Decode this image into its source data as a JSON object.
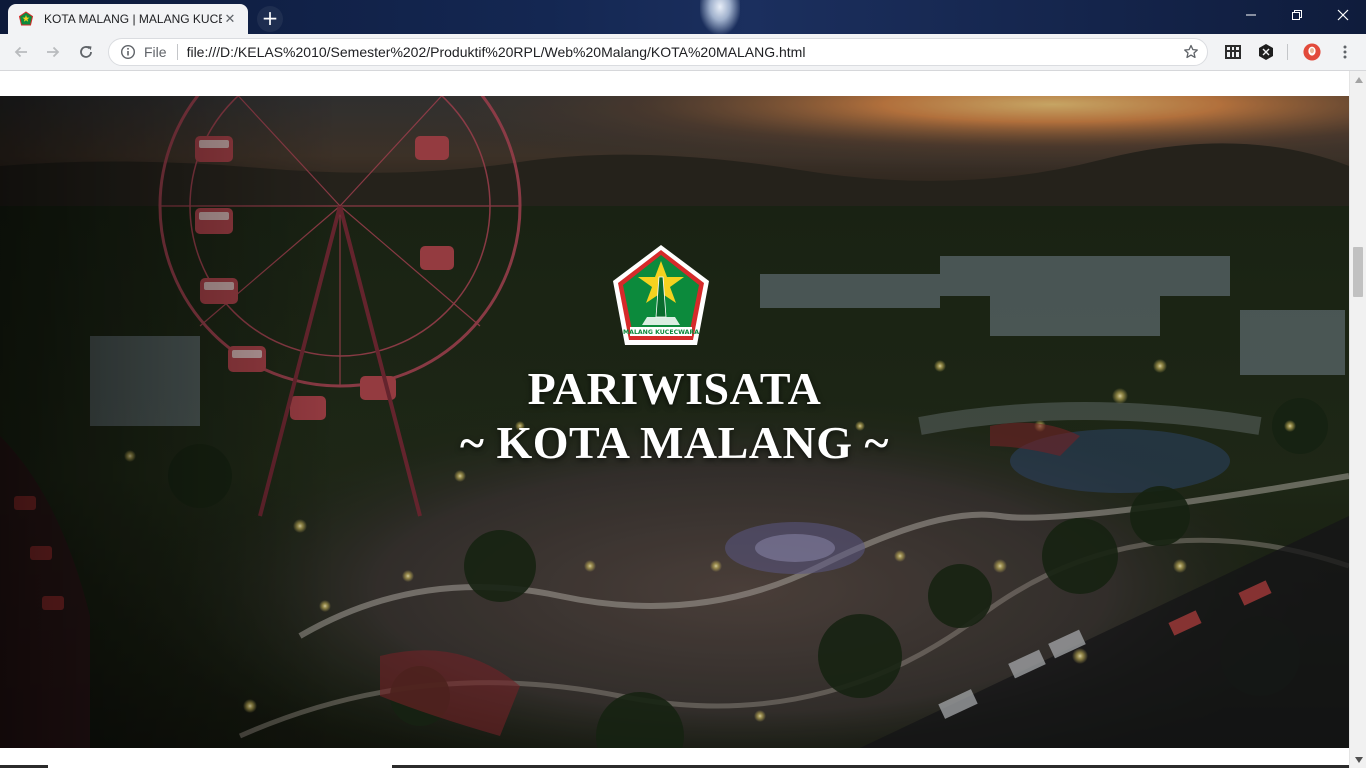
{
  "browser": {
    "tab": {
      "title": "KOTA MALANG | MALANG KUCECWARA",
      "close_glyph": "✕",
      "favicon": "malang-crest-icon"
    },
    "new_tab_glyph": "+",
    "window_controls": {
      "minimize": "minimize-icon",
      "maximize": "restore-icon",
      "close": "close-icon"
    },
    "toolbar": {
      "back": "arrow-left-icon",
      "forward": "arrow-right-icon",
      "reload": "reload-icon",
      "scheme_label": "File",
      "url": "file:///D:/KELAS%2010/Semester%202/Produktif%20RPL/Web%20Malang/KOTA%20MALANG.html",
      "bookmark": "star-icon",
      "extensions": [
        "grid-extension-icon",
        "hexagon-extension-icon",
        "profile-avatar-icon"
      ],
      "menu": "more-vertical-icon"
    }
  },
  "page": {
    "hero": {
      "logo": "malang-crest-logo",
      "logo_text": "MALANG KUCECWARA",
      "title_line1": "PARIWISATA",
      "title_line2": "~ KOTA MALANG ~"
    },
    "scrollbar": {
      "position_fraction": 0.26
    }
  },
  "colors": {
    "chrome_bg": "#f2f3f5",
    "titlebar_bg": "#142752",
    "crest_green": "#0c8a3c",
    "crest_red": "#d62a2a",
    "crest_yellow": "#f5d21f",
    "title_text": "#ffffff"
  }
}
